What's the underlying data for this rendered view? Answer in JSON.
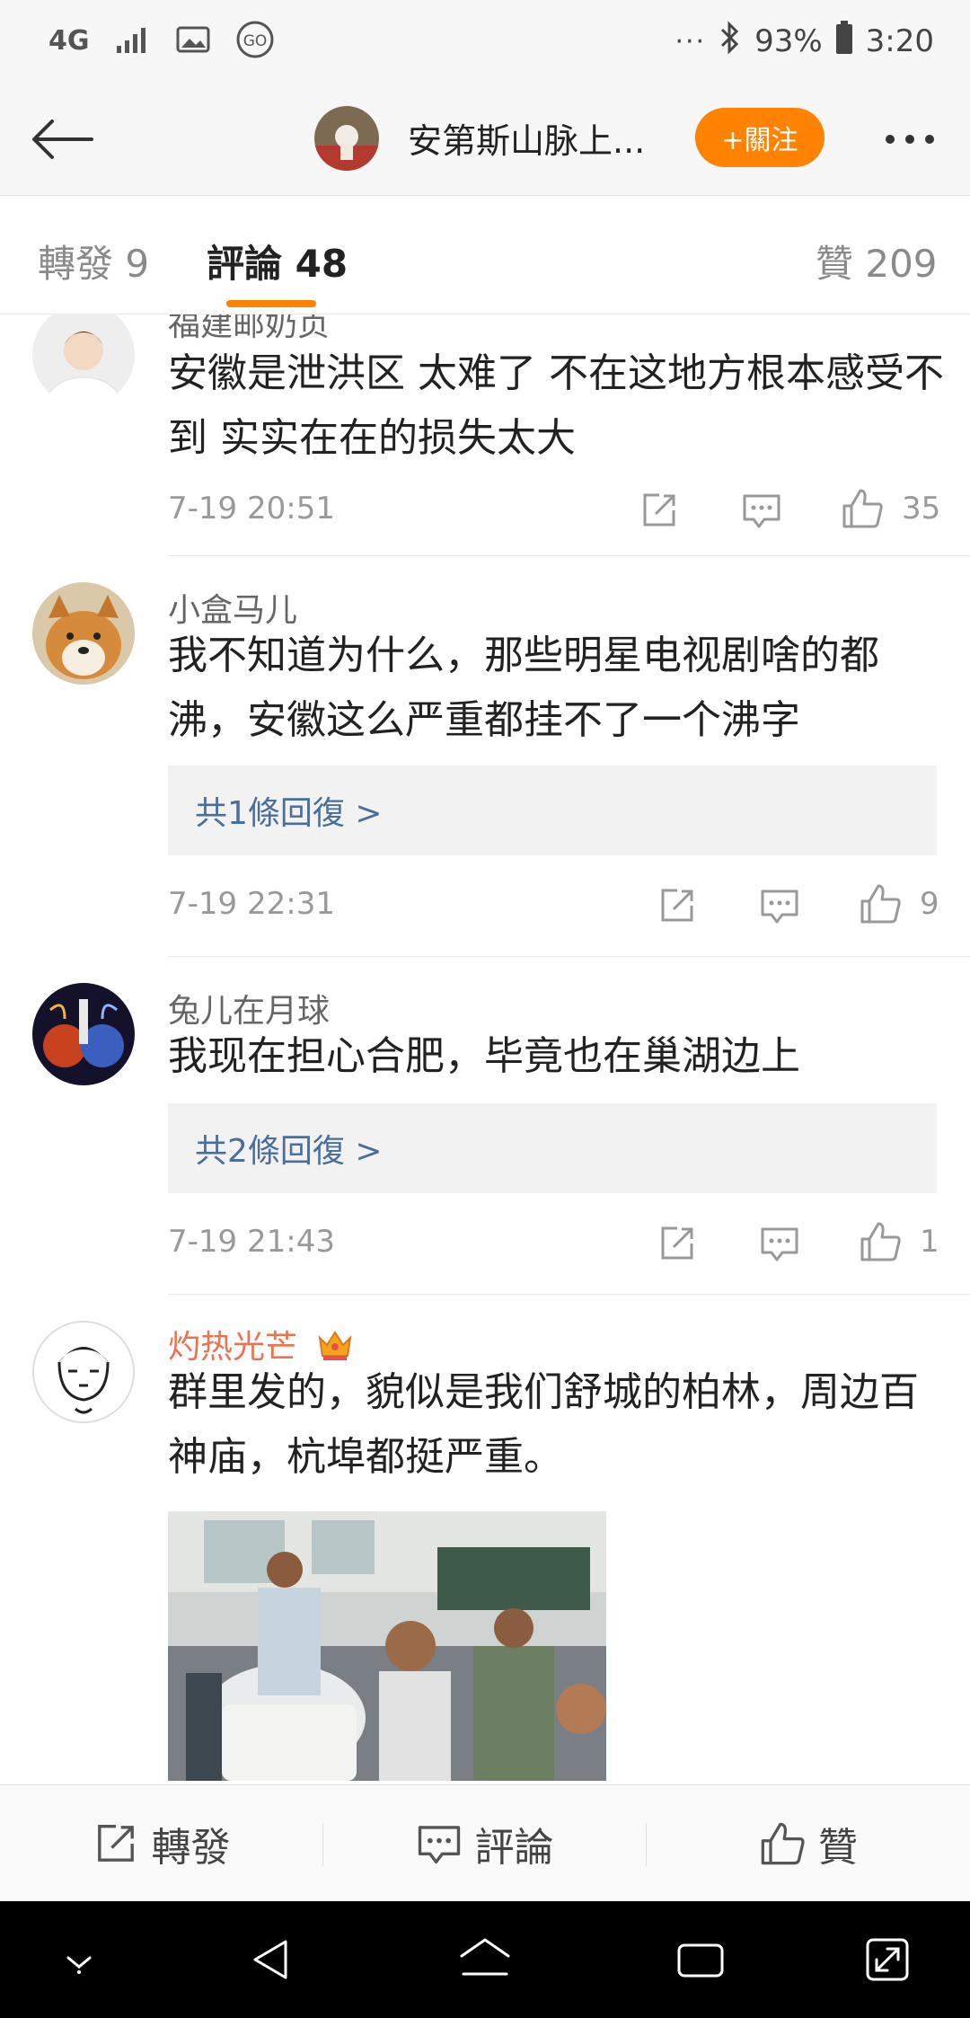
{
  "status_bar": {
    "network": "4G",
    "battery": "93%",
    "time": "3:20",
    "icons": [
      "network-4g-icon",
      "signal-icon",
      "image-icon",
      "go-icon",
      "more-dots-icon",
      "bluetooth-icon",
      "battery-icon"
    ]
  },
  "header": {
    "title": "安第斯山脉上...",
    "follow_label": "+關注"
  },
  "tabs": {
    "repost": "轉發 9",
    "comments": "評論 48",
    "likes": "贊 209"
  },
  "comments": [
    {
      "username": "福建邮奶贞",
      "text": "安徽是泄洪区 太难了 不在这地方根本感受不到  实实在在的损失太大",
      "time": "7-19 20:51",
      "likes": "35"
    },
    {
      "username": "小盒马儿",
      "text": "我不知道为什么，那些明星电视剧啥的都沸，安徽这么严重都挂不了一个沸字",
      "replies": "共1條回復 >",
      "time": "7-19 22:31",
      "likes": "9"
    },
    {
      "username": "兔儿在月球",
      "text": "我现在担心合肥，毕竟也在巢湖边上",
      "replies": "共2條回復 >",
      "time": "7-19 21:43",
      "likes": "1"
    },
    {
      "username": "灼热光芒",
      "text": "群里发的，貌似是我们舒城的柏林，周边百神庙，杭埠都挺严重。",
      "vip": true
    }
  ],
  "bottom_bar": {
    "repost": "轉發",
    "comment": "評論",
    "like": "贊"
  },
  "colors": {
    "accent": "#ff8200",
    "reply_link": "#4a6f9b",
    "vip_name": "#eb7350"
  }
}
